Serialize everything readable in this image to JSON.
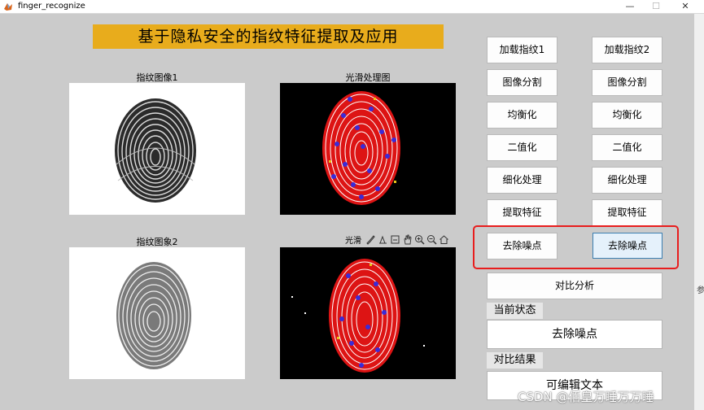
{
  "window": {
    "title": "finger_recognize",
    "minimize_glyph": "—",
    "maximize_glyph": "☐",
    "close_glyph": "✕"
  },
  "banner": {
    "text": "基于隐私安全的指纹特征提取及应用",
    "color": "#e8ac1c"
  },
  "axes": {
    "fp1_title": "指纹图像1",
    "smooth_title": "光滑处理图",
    "fp2_title": "指纹图象2",
    "toolbar_label": "光滑"
  },
  "toolbar_icons": [
    "brush-icon",
    "data-tip-icon",
    "save-icon",
    "pan-hand-icon",
    "zoom-in-icon",
    "zoom-out-icon",
    "home-icon"
  ],
  "buttons": {
    "load_fp1": "加载指纹1",
    "load_fp2": "加载指纹2",
    "segment_1": "图像分割",
    "segment_2": "图像分割",
    "equalize_1": "均衡化",
    "equalize_2": "均衡化",
    "binarize_1": "二值化",
    "binarize_2": "二值化",
    "thin_1": "细化处理",
    "thin_2": "细化处理",
    "extract_1": "提取特征",
    "extract_2": "提取特征",
    "denoise_1": "去除噪点",
    "denoise_2": "去除噪点",
    "compare": "对比分析"
  },
  "status": {
    "label": "当前状态",
    "value": "去除噪点"
  },
  "result": {
    "label": "对比结果",
    "value": "可编辑文本"
  },
  "side_char": "参",
  "watermark": "CSDN @佰皇万睡万万睡",
  "colors": {
    "highlight": "#e81d1d",
    "active_button_bg": "#e5f1fb",
    "active_button_border": "#3c7fb1"
  }
}
